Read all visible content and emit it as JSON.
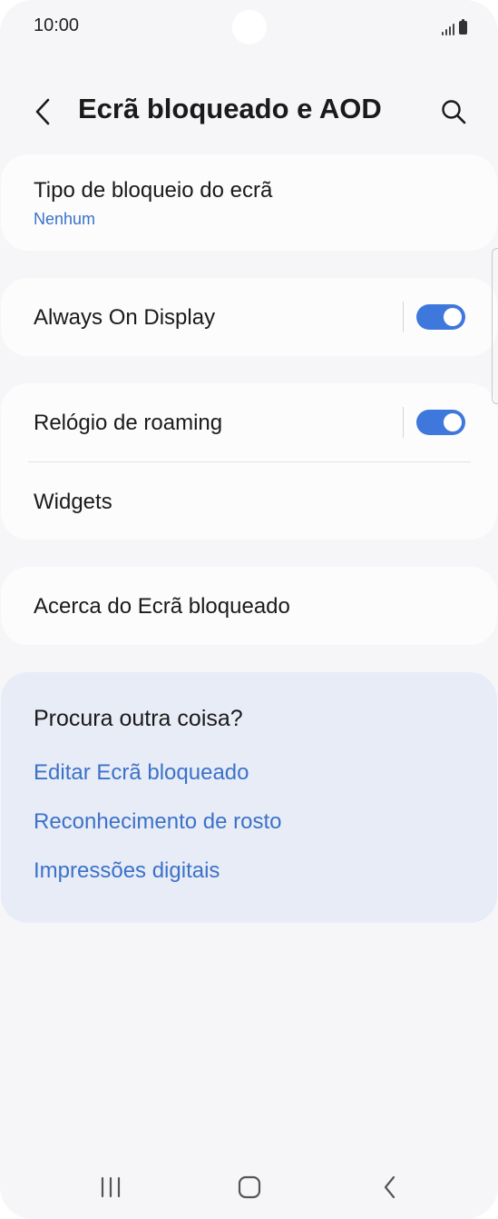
{
  "status_bar": {
    "time": "10:00"
  },
  "header": {
    "title": "Ecrã bloqueado e AOD",
    "back_icon": "chevron-left-icon",
    "search_icon": "search-icon"
  },
  "settings": {
    "lock_type": {
      "title": "Tipo de bloqueio do ecrã",
      "value": "Nenhum"
    },
    "always_on_display": {
      "title": "Always On Display",
      "enabled": true
    },
    "roaming_clock": {
      "title": "Relógio de roaming",
      "enabled": true
    },
    "widgets": {
      "title": "Widgets"
    },
    "about": {
      "title": "Acerca do Ecrã bloqueado"
    }
  },
  "suggestions": {
    "heading": "Procura outra coisa?",
    "links": [
      "Editar Ecrã bloqueado",
      "Reconhecimento de rosto",
      "Impressões digitais"
    ]
  },
  "colors": {
    "accent": "#3f78dc",
    "link": "#3b72c8",
    "background": "#f6f6f8",
    "card": "#fcfcfd",
    "suggest_card": "#e8ecf7"
  },
  "nav_bar": {
    "icons": [
      "recent-apps-icon",
      "home-icon",
      "back-icon"
    ]
  }
}
